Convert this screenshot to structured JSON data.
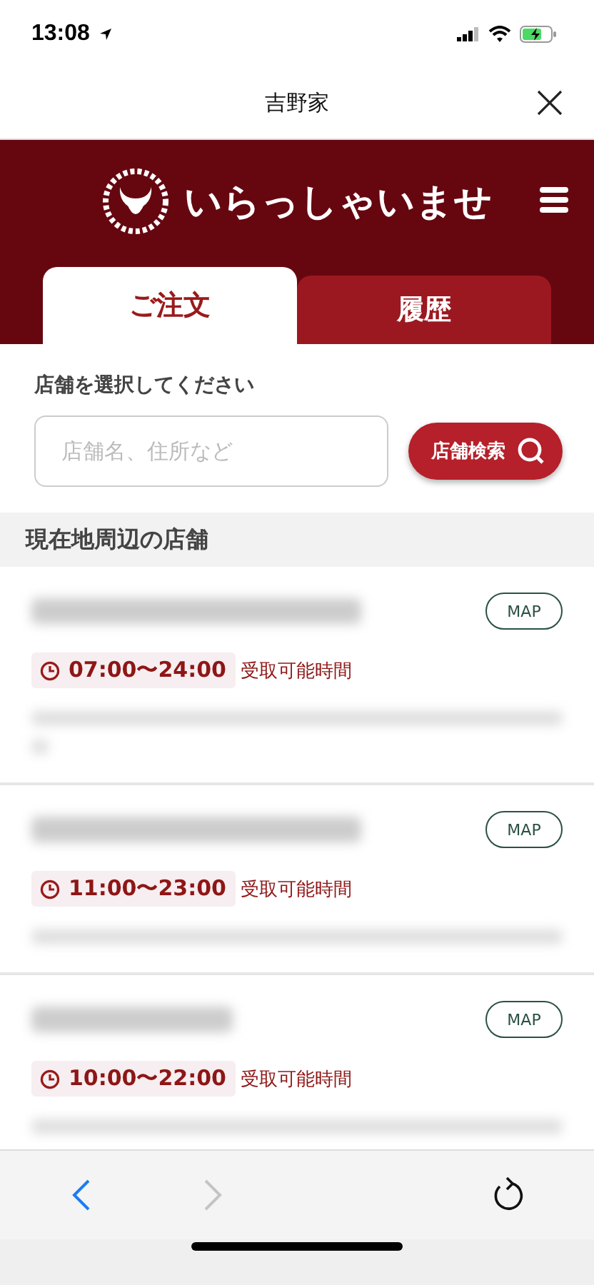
{
  "status_bar": {
    "time": "13:08"
  },
  "browser": {
    "title": "吉野家"
  },
  "header": {
    "greeting": "いらっしゃいませ"
  },
  "tabs": [
    {
      "label": "ご注文",
      "selected": true
    },
    {
      "label": "履歴",
      "selected": false
    }
  ],
  "search": {
    "label": "店舗を選択してください",
    "placeholder": "店舗名、住所など",
    "button": "店舗検索"
  },
  "section": {
    "title": "現在地周辺の店舗"
  },
  "stores": [
    {
      "hours": "07:00〜24:00",
      "hours_label": "受取可能時間",
      "map": "MAP"
    },
    {
      "hours": "11:00〜23:00",
      "hours_label": "受取可能時間",
      "map": "MAP"
    },
    {
      "hours": "10:00〜22:00",
      "hours_label": "受取可能時間",
      "map": "MAP"
    }
  ],
  "toolbar": {
    "back_enabled": true,
    "forward_enabled": false
  }
}
